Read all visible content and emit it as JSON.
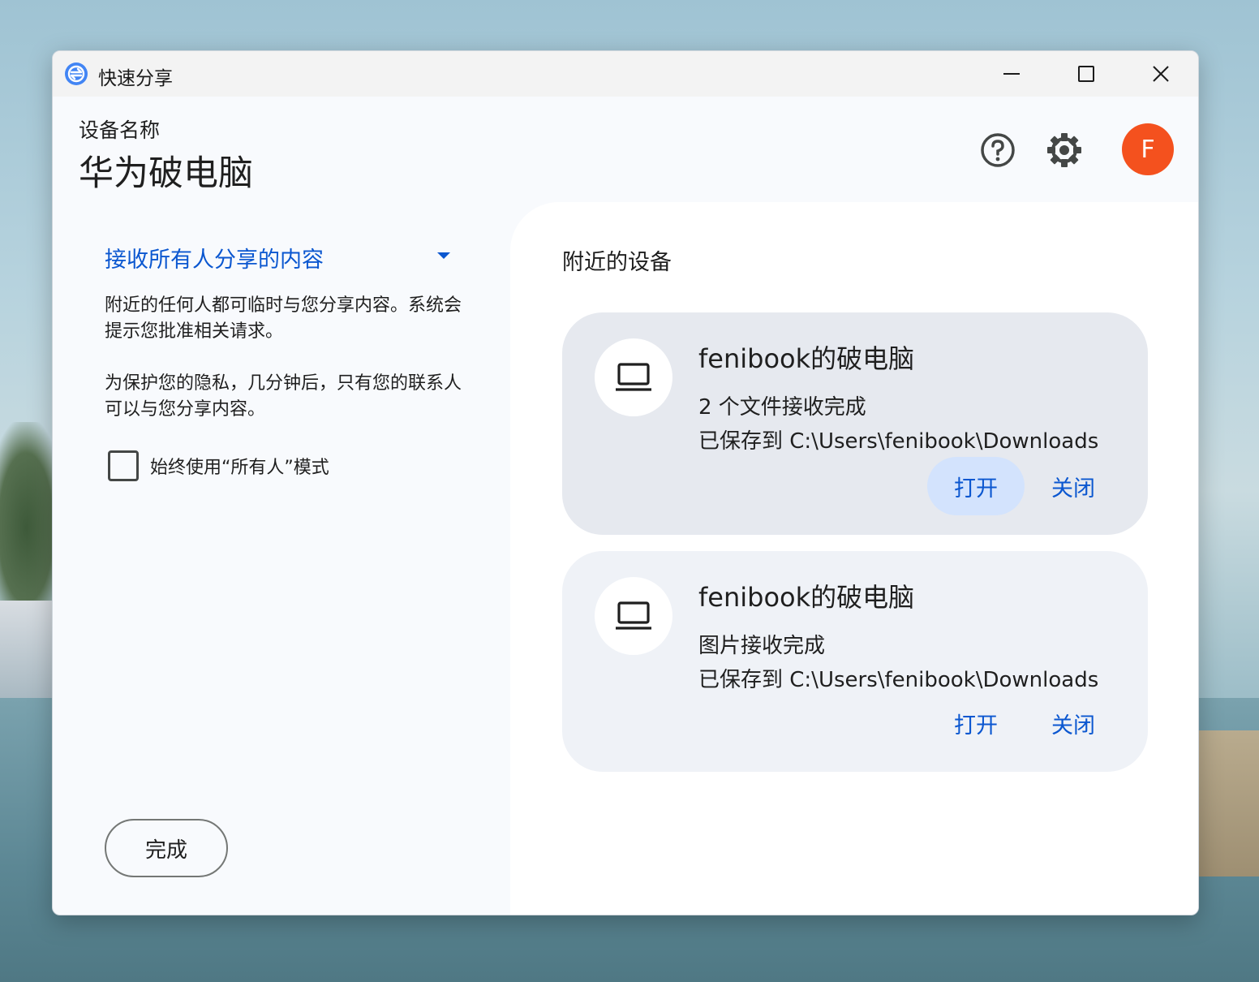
{
  "window": {
    "title": "快速分享"
  },
  "header": {
    "device_label": "设备名称",
    "device_name": "华为破电脑",
    "avatar_letter": "F"
  },
  "left": {
    "mode_label": "接收所有人分享的内容",
    "desc1": "附近的任何人都可临时与您分享内容。系统会提示您批准相关请求。",
    "desc2": "为保护您的隐私，几分钟后，只有您的联系人可以与您分享内容。",
    "always_label": "始终使用“所有人”模式",
    "always_checked": false,
    "done_label": "完成"
  },
  "right": {
    "title": "附近的设备",
    "cards": [
      {
        "name": "fenibook的破电脑",
        "status": "2 个文件接收完成",
        "path": "已保存到 C:\\Users\\fenibook\\Downloads",
        "open_label": "打开",
        "close_label": "关闭"
      },
      {
        "name": "fenibook的破电脑",
        "status": "图片接收完成",
        "path": "已保存到 C:\\Users\\fenibook\\Downloads",
        "open_label": "打开",
        "close_label": "关闭"
      }
    ]
  },
  "colors": {
    "accent": "#0b57d0",
    "avatar": "#f4511e",
    "card_active": "#e6e9ef",
    "card": "#eff2f7"
  }
}
